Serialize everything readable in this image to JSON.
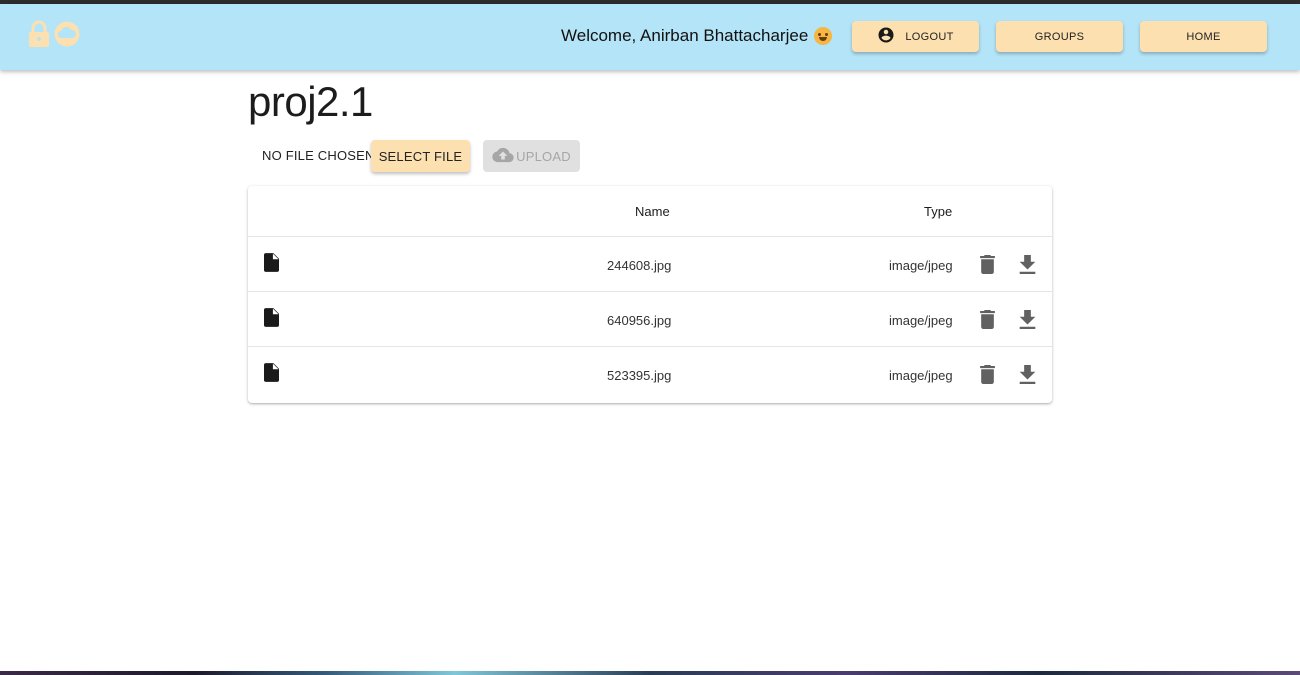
{
  "header": {
    "brand_icons": [
      "lock-icon",
      "cloud-icon"
    ],
    "welcome_text": "Welcome, Anirban Bhattacharjee",
    "welcome_emoji": "hugging-face-emoji",
    "logout_label": "LOGOUT",
    "logout_icon": "account-circle-icon",
    "groups_label": "GROUPS",
    "home_label": "HOME"
  },
  "project": {
    "title": "proj2.1"
  },
  "upload_bar": {
    "file_status": "NO FILE CHOSEN",
    "select_label": "SELECT FILE",
    "upload_label": "UPLOAD",
    "upload_icon": "cloud-upload-icon"
  },
  "files_table": {
    "columns": [
      "Name",
      "Type"
    ],
    "rows": [
      {
        "name": "244608.jpg",
        "type": "image/jpeg"
      },
      {
        "name": "640956.jpg",
        "type": "image/jpeg"
      },
      {
        "name": "523395.jpg",
        "type": "image/jpeg"
      }
    ],
    "row_icon": "file-icon",
    "action_icons": [
      "delete-icon",
      "download-icon"
    ]
  },
  "colors": {
    "appbar": "#b4e4f7",
    "button_accent": "#fde0b0",
    "brand_icon": "#fde0b0",
    "disabled": "#e0e0e0"
  }
}
